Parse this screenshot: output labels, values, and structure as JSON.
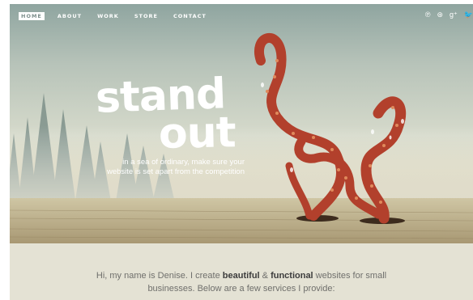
{
  "nav": {
    "items": [
      {
        "label": "HOME",
        "active": true
      },
      {
        "label": "ABOUT",
        "active": false
      },
      {
        "label": "WORK",
        "active": false
      },
      {
        "label": "STORE",
        "active": false
      },
      {
        "label": "CONTACT",
        "active": false
      }
    ]
  },
  "social": {
    "icons": [
      {
        "name": "pinterest-icon",
        "glyph": "℗"
      },
      {
        "name": "dribbble-icon",
        "glyph": "⊛"
      },
      {
        "name": "google-plus-icon",
        "glyph": "g⁺"
      },
      {
        "name": "twitter-icon",
        "glyph": "🐦"
      }
    ]
  },
  "hero": {
    "headline_line1": "stand",
    "headline_line2": "out",
    "tagline_line1": "in a sea of ordinary, make sure your",
    "tagline_line2": "website is set apart from the competition"
  },
  "intro": {
    "part1": "Hi, my name is Denise. I create ",
    "bold1": "beautiful",
    "part2": " & ",
    "bold2": "functional",
    "part3": " websites for small businesses. Below are a few services I provide:"
  },
  "colors": {
    "tentacle": "#b2402c",
    "tentacle_dark": "#7c2a1c",
    "sucker": "#e0895c",
    "intro_bg": "#e4e2d4"
  }
}
